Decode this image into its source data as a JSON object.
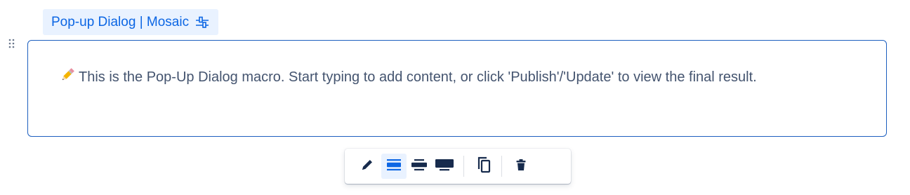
{
  "macro": {
    "title": "Pop-up Dialog | Mosaic",
    "settings_icon": "sliders-icon",
    "drag_icon": "drag-handle-icon"
  },
  "body": {
    "pencil_emoji": "✏️",
    "placeholder_text": "This is the Pop-Up Dialog macro. Start typing to add content, or click 'Publish'/'Update' to view the final result."
  },
  "toolbar": {
    "buttons": [
      {
        "icon": "edit-pencil-icon",
        "active": false
      },
      {
        "icon": "width-default-icon",
        "active": true
      },
      {
        "icon": "width-wide-icon",
        "active": false
      },
      {
        "icon": "width-full-icon",
        "active": false
      },
      {
        "icon": "copy-icon",
        "active": false
      },
      {
        "icon": "delete-icon",
        "active": false
      }
    ]
  },
  "colors": {
    "accent": "#0c66e4",
    "tag_background": "#e9f2ff",
    "border": "#1d5fbf",
    "text": "#44546f",
    "icon_dark": "#172b4d"
  }
}
